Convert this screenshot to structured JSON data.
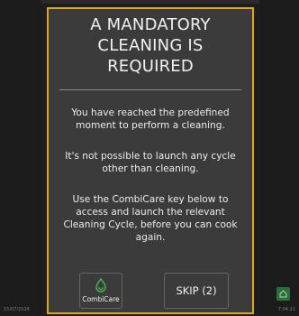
{
  "dialog": {
    "title_lines": [
      "A MANDATORY",
      "CLEANING IS",
      "REQUIRED"
    ],
    "messages": [
      "You have reached the predefined moment to perform a cleaning.",
      "It's not possible to launch any cycle other than cleaning.",
      "Use the CombiCare key below to access and launch the relevant Cleaning Cycle, before you can cook again."
    ],
    "combicare_label": "CombiCare",
    "skip_label": "SKIP (2)"
  },
  "status": {
    "date": "15/07/2024",
    "time": "7:04:21"
  },
  "colors": {
    "border_accent": "#d9a82a",
    "combicare_green": "#3fae4a",
    "dialog_bg": "#3b3b3b"
  },
  "icons": {
    "combicare": "droplet-icon",
    "home": "home-icon"
  }
}
